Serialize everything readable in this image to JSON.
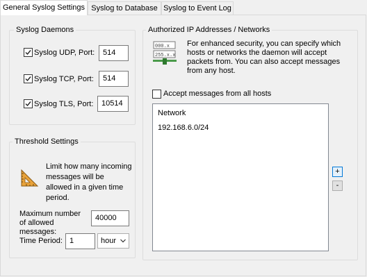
{
  "tabs": [
    {
      "label": "General Syslog Settings"
    },
    {
      "label": "Syslog to Database"
    },
    {
      "label": "Syslog to Event Log"
    }
  ],
  "daemons": {
    "title": "Syslog Daemons",
    "udp": {
      "label": "Syslog UDP, Port:",
      "checked": true,
      "port": "514"
    },
    "tcp": {
      "label": "Syslog TCP, Port:",
      "checked": true,
      "port": "514"
    },
    "tls": {
      "label": "Syslog TLS, Port:",
      "checked": true,
      "port": "10514"
    }
  },
  "threshold": {
    "title": "Threshold Settings",
    "description": "Limit how many incoming messages will be allowed in a given time period.",
    "max_label": "Maximum number of allowed messages:",
    "max_value": "40000",
    "period_label": "Time Period:",
    "period_value": "1",
    "period_unit": "hour",
    "icon": "ruler-triangle-icon"
  },
  "authorized": {
    "title": "Authorized IP Addresses / Networks",
    "description": "For enhanced security, you can specify which hosts or networks the daemon will accept packets from. You can also accept messages from any host.",
    "accept_all_label": "Accept messages from all hosts",
    "accept_all_checked": false,
    "list_header": "Network",
    "networks": [
      "192.168.6.0/24"
    ],
    "add_label": "+",
    "remove_label": "-",
    "icon": "network-ip-icon"
  }
}
